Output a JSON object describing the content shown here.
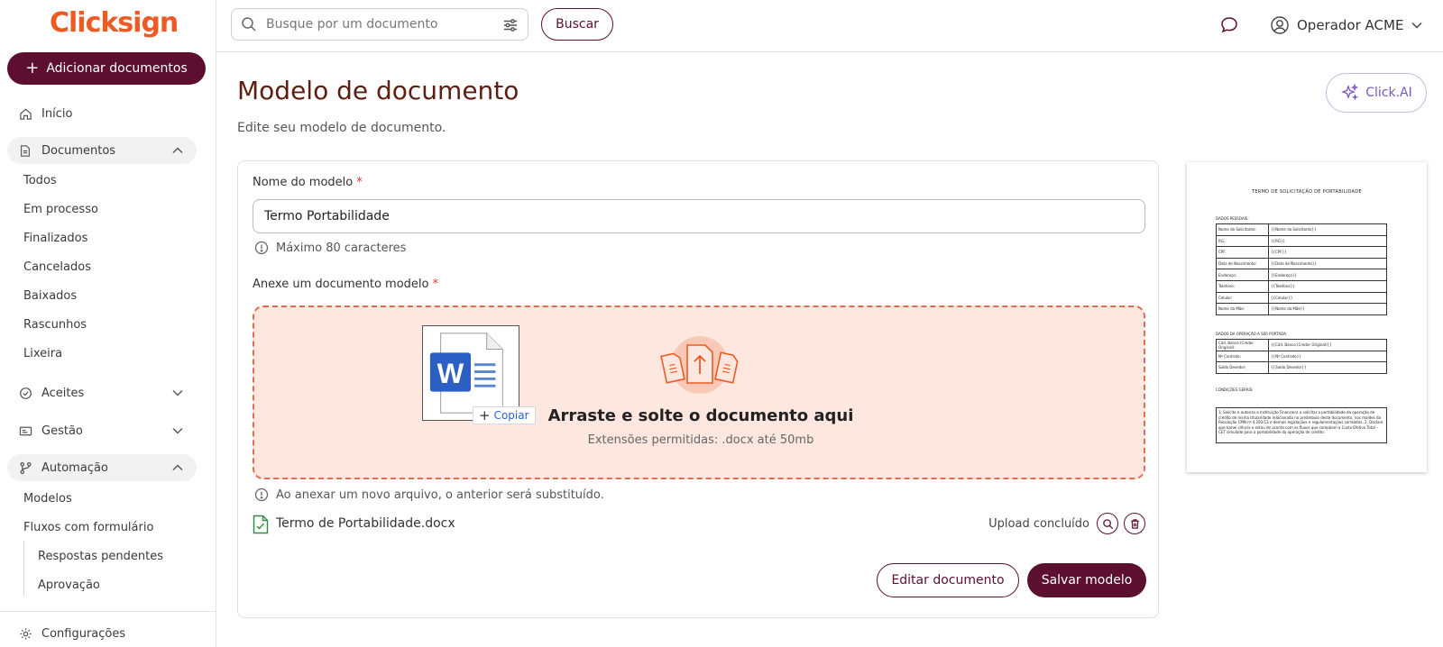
{
  "brand": {
    "logo_text": "Clicksign",
    "logo_color": "#ee5a24",
    "primary_color": "#5c0f2e"
  },
  "sidebar": {
    "add_button_label": "Adicionar documentos",
    "inicio": "Início",
    "documentos": {
      "label": "Documentos",
      "items": [
        "Todos",
        "Em processo",
        "Finalizados",
        "Cancelados",
        "Baixados",
        "Rascunhos",
        "Lixeira"
      ]
    },
    "aceites": "Aceites",
    "gestao": "Gestão",
    "automacao": {
      "label": "Automação",
      "items": [
        "Modelos",
        "Fluxos com formulário"
      ],
      "sub_items": [
        "Respostas pendentes",
        "Aprovação"
      ]
    },
    "configuracoes": "Configurações"
  },
  "topbar": {
    "search_placeholder": "Busque por um documento",
    "search_button": "Buscar",
    "user_name": "Operador ACME"
  },
  "main": {
    "title": "Modelo de documento",
    "subtitle": "Edite seu modelo de documento.",
    "clickai_label": "Click.AI",
    "name_label": "Nome do modelo",
    "name_value": "Termo Portabilidade",
    "name_hint": "Máximo 80 caracteres",
    "attach_label": "Anexe um documento modelo",
    "required_mark": "*",
    "dropzone_title": "Arraste e solte o documento aqui",
    "dropzone_sub": "Extensões permitidas: .docx até 50mb",
    "copy_badge": "Copiar",
    "replace_hint": "Ao anexar um novo arquivo, o anterior será substituído.",
    "file_name": "Termo de Portabilidade.docx",
    "upload_status": "Upload concluído",
    "edit_button": "Editar documento",
    "save_button": "Salvar modelo"
  },
  "preview": {
    "title": "TERMO DE SOLICITAÇÃO DE PORTABILIDADE",
    "section1": "DADOS PESSOAIS:",
    "rows1": [
      [
        "Nome do Solicitante:",
        "{{Nome do Solicitante}}"
      ],
      [
        "RG:",
        "{{RG}}"
      ],
      [
        "CPF:",
        "{{CPF}}"
      ],
      [
        "Data de Nascimento:",
        "{{Data de Nascimento}}"
      ],
      [
        "Endereço:",
        "{{Endereço}}"
      ],
      [
        "Telefone:",
        "{{Telefone}}"
      ],
      [
        "Celular:",
        "{{Celular}}"
      ],
      [
        "Nome da Mãe:",
        "{{Nome da Mãe}}"
      ]
    ],
    "section2": "DADOS DA OPERAÇÃO A SER PORTADA:",
    "rows2": [
      [
        "Cód. Banco (Credor Original):",
        "{{Cód. Banco (Credor Original)}}"
      ],
      [
        "Nº Contrato:",
        "{{Nº Contrato}}"
      ],
      [
        "Saldo Devedor:",
        "{{Saldo Devedor}}"
      ]
    ],
    "section3": "CONDIÇÕES GERAIS:",
    "conditions": "1. Solicito e autorizo a Instituição Financeira a solicitar a portabilidade da operação de crédito de minha titularidade relacionada no preâmbulo deste documento, nos moldes da Resolução CMN nº 4.292/13 e demais legislações e regulamentações correlatas. 2. Declaro que tomei ciência e estou de acordo com os fluxos que compõem o Custo Efetivo Total – CET simulado para a portabilidade da operação de crédito."
  }
}
